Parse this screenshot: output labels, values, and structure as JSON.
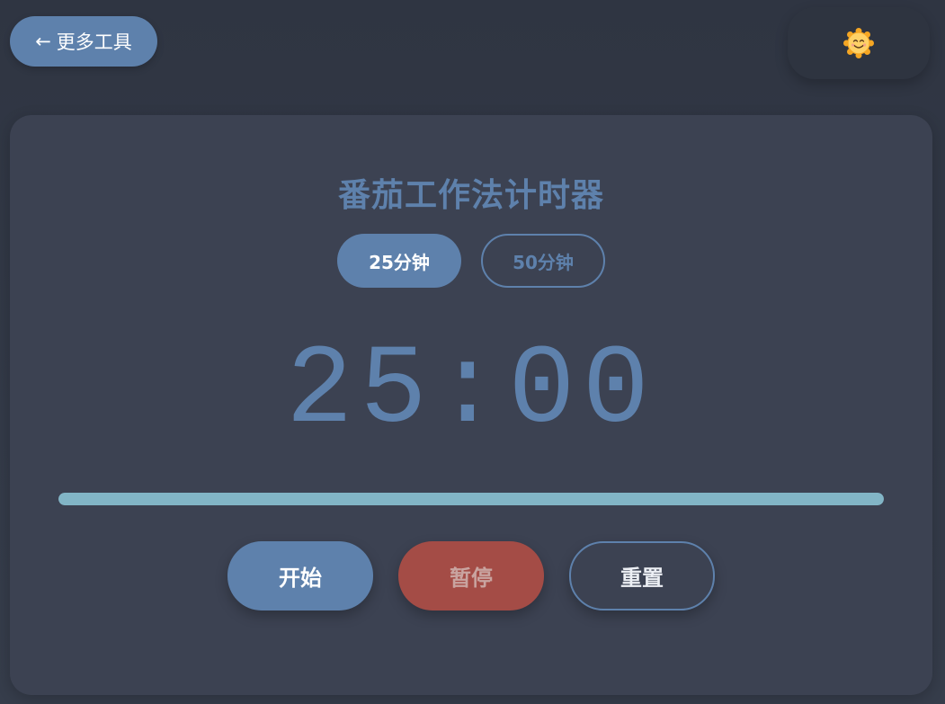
{
  "nav": {
    "back_arrow": "←",
    "back_label": "更多工具"
  },
  "theme_toggle": {
    "icon": "sun-smiley-icon",
    "colors": {
      "petals": "#f5a623",
      "face": "#ffd166"
    }
  },
  "pomodoro": {
    "title": "番茄工作法计时器",
    "modes": [
      {
        "label": "25分钟",
        "active": true
      },
      {
        "label": "50分钟",
        "active": false
      }
    ],
    "time_display": "25:00",
    "progress": 1.0,
    "controls": {
      "start_label": "开始",
      "pause_label": "暂停",
      "reset_label": "重置"
    }
  },
  "colors": {
    "accent": "#5e81ac",
    "progress_fill": "#88c0d0",
    "pause": "#a44c46",
    "card_bg": "#3c4252",
    "page_bg": "#2f3542"
  }
}
